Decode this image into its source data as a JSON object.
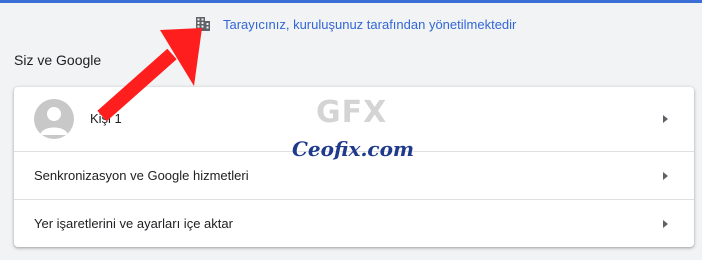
{
  "colors": {
    "accent": "#3b6fd6",
    "link": "#3367d6",
    "arrow": "#ff1e1e",
    "background": "#f1f3f4"
  },
  "managed_notice": {
    "icon": "building-icon",
    "text": "Tarayıcınız, kuruluşunuz tarafından yönetilmektedir"
  },
  "section": {
    "title": "Siz ve Google"
  },
  "rows": [
    {
      "label": "Kişi 1",
      "icon": "chevron-right-icon"
    },
    {
      "label": "Senkronizasyon ve Google hizmetleri",
      "icon": "chevron-right-icon"
    },
    {
      "label": "Yer işaretlerini ve ayarları içe aktar",
      "icon": "chevron-right-icon"
    }
  ],
  "watermark": {
    "logo": "GFX",
    "site": "Ceofix.com"
  }
}
